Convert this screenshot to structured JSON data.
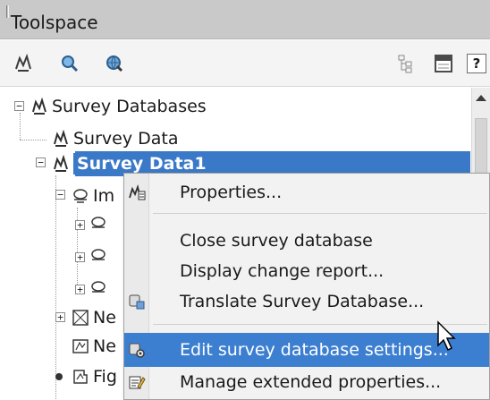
{
  "window": {
    "title": "Toolspace"
  },
  "toolbar": {
    "help_label": "?"
  },
  "tree": {
    "root": "Survey Databases",
    "items": [
      {
        "label": "Survey Data"
      },
      {
        "label": "Survey Data1"
      },
      {
        "label": "Im"
      },
      {
        "label": "Ne"
      },
      {
        "label": "Ne"
      },
      {
        "label": "Fig"
      }
    ]
  },
  "context_menu": {
    "items": [
      {
        "label": "Properties..."
      },
      {
        "label": "Close survey database"
      },
      {
        "label": "Display change report..."
      },
      {
        "label": "Translate Survey Database..."
      },
      {
        "label": "Edit survey database settings..."
      },
      {
        "label": "Manage extended properties..."
      }
    ]
  },
  "colors": {
    "selection": "#3a79c7",
    "menu_hover": "#3c7fd0"
  },
  "icons": [
    "survey-database-icon",
    "import-icon",
    "network-icon",
    "figure-icon",
    "properties-icon",
    "settings-icon"
  ]
}
